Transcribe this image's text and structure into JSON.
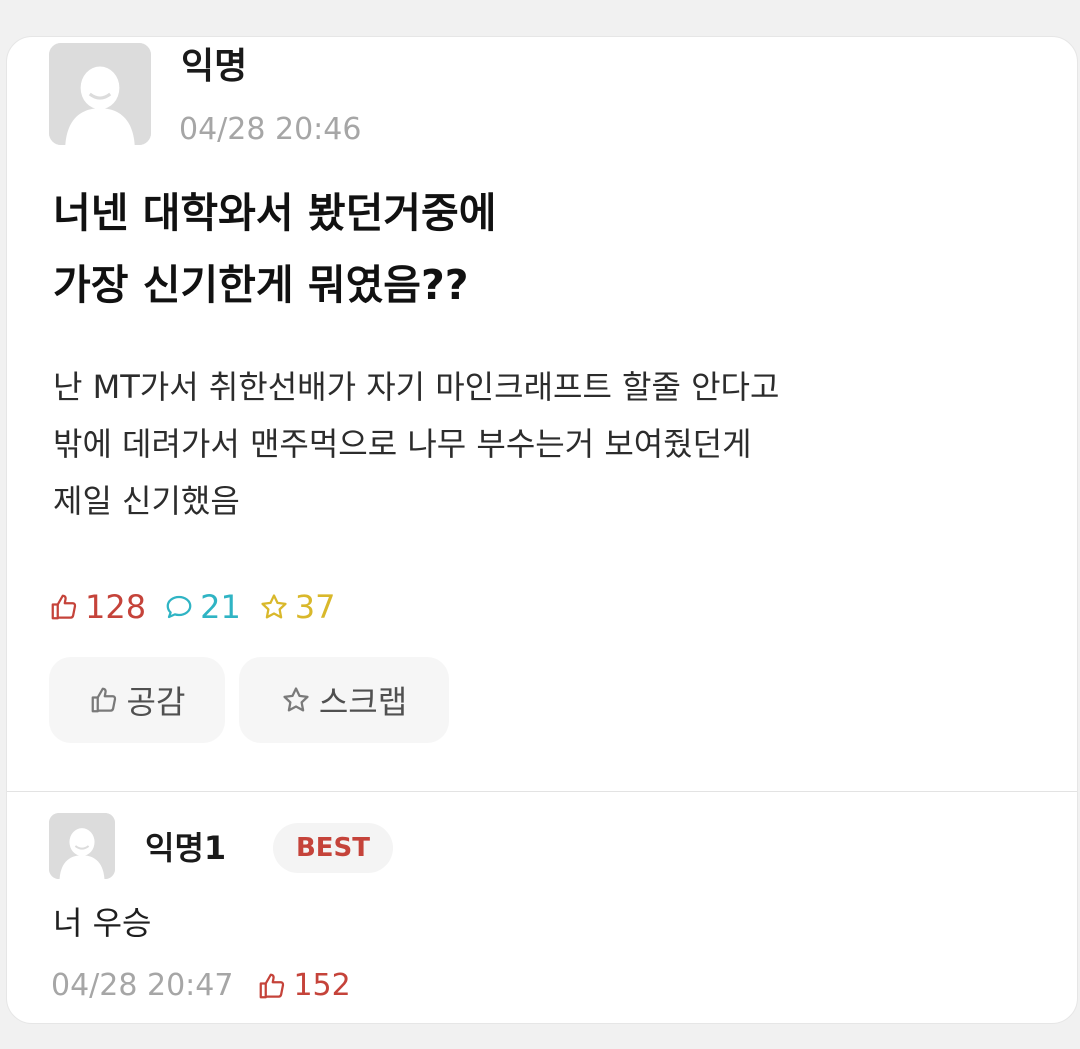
{
  "post": {
    "author": "익명",
    "timestamp": "04/28 20:46",
    "title_lines": [
      "너넨 대학와서 봤던거중에",
      "가장 신기한게 뭐였음??"
    ],
    "body_lines": [
      "난 MT가서 취한선배가 자기 마인크래프트 할줄 안다고",
      "밖에 데려가서 맨주먹으로 나무 부수는거 보여줬던게",
      "제일 신기했음"
    ],
    "stats": {
      "likes": "128",
      "comments": "21",
      "scraps": "37"
    },
    "actions": {
      "like_label": "공감",
      "scrap_label": "스크랩"
    }
  },
  "comment": {
    "author": "익명1",
    "badge": "BEST",
    "text": "너 우승",
    "timestamp": "04/28 20:47",
    "likes": "152"
  },
  "colors": {
    "like": "#c5433a",
    "comment": "#2fb4c4",
    "scrap": "#d9b82b",
    "meta": "#a6a6a6"
  },
  "icons": [
    "avatar-icon",
    "thumbs-up-icon",
    "comment-bubble-icon",
    "star-icon"
  ]
}
